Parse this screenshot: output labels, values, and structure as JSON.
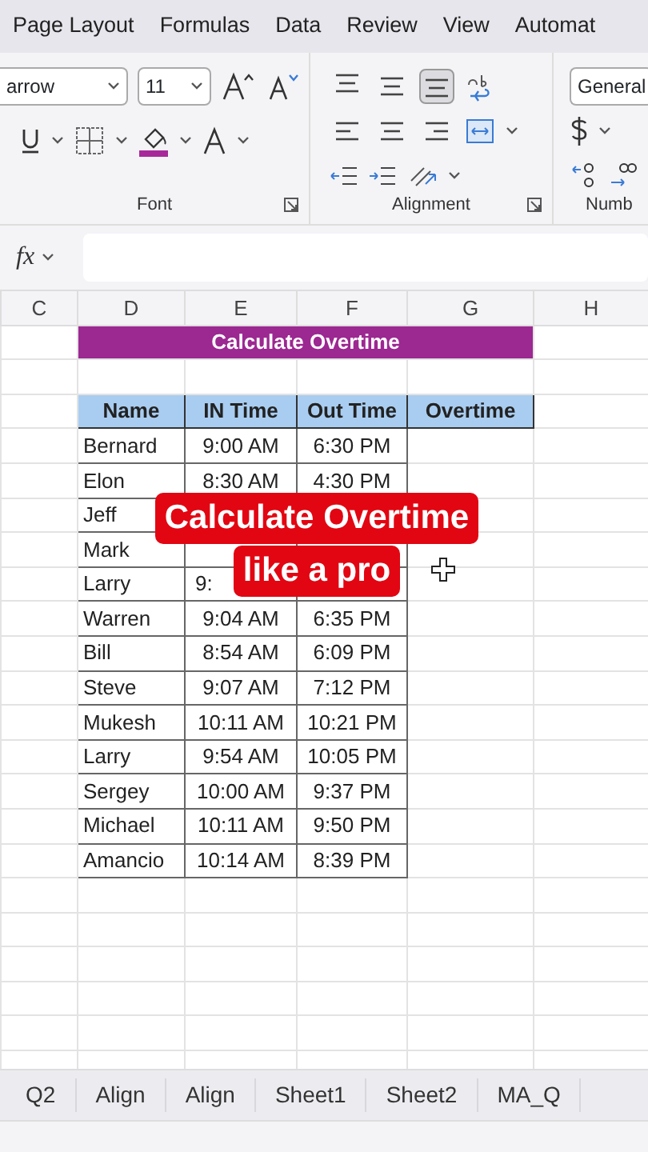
{
  "ribbon_tabs": [
    "Page Layout",
    "Formulas",
    "Data",
    "Review",
    "View",
    "Automat"
  ],
  "font_group": {
    "font_name": "arrow",
    "font_size": "11",
    "label": "Font"
  },
  "alignment_group": {
    "vertical": [
      {
        "selected": false
      },
      {
        "selected": false
      },
      {
        "selected": true
      }
    ],
    "label": "Alignment"
  },
  "number_group": {
    "format": "General",
    "label": "Numb"
  },
  "formula_bar": {
    "fx": "fx"
  },
  "columns": [
    "C",
    "D",
    "E",
    "F",
    "G",
    "H"
  ],
  "sheet_title": "Calculate Overtime",
  "table": {
    "columns": [
      "Name",
      "IN Time",
      "Out Time",
      "Overtime"
    ],
    "rows": [
      {
        "name": "Bernard",
        "in_time": "9:00 AM",
        "out_time": "6:30 PM"
      },
      {
        "name": "Elon",
        "in_time": "8:30 AM",
        "out_time": "4:30 PM"
      },
      {
        "name": "Jeff"
      },
      {
        "name": "Mark"
      },
      {
        "name": "Larry",
        "in_time": "9:"
      },
      {
        "name": "Warren",
        "in_time": "9:04 AM",
        "out_time": "6:35 PM"
      },
      {
        "name": "Bill",
        "in_time": "8:54 AM",
        "out_time": "6:09 PM"
      },
      {
        "name": "Steve",
        "in_time": "9:07 AM",
        "out_time": "7:12 PM"
      },
      {
        "name": "Mukesh",
        "in_time": "10:11 AM",
        "out_time": "10:21 PM"
      },
      {
        "name": "Larry",
        "in_time": "9:54 AM",
        "out_time": "10:05 PM"
      },
      {
        "name": "Sergey",
        "in_time": "10:00 AM",
        "out_time": "9:37 PM"
      },
      {
        "name": "Michael",
        "in_time": "10:11 AM",
        "out_time": "9:50 PM"
      },
      {
        "name": "Amancio",
        "in_time": "10:14 AM",
        "out_time": "8:39 PM"
      }
    ]
  },
  "caption": [
    "Calculate Overtime",
    "like a pro"
  ],
  "sheet_tabs": [
    "Q2",
    "Align",
    "Align",
    "Sheet1",
    "Sheet2",
    "MA_Q"
  ]
}
